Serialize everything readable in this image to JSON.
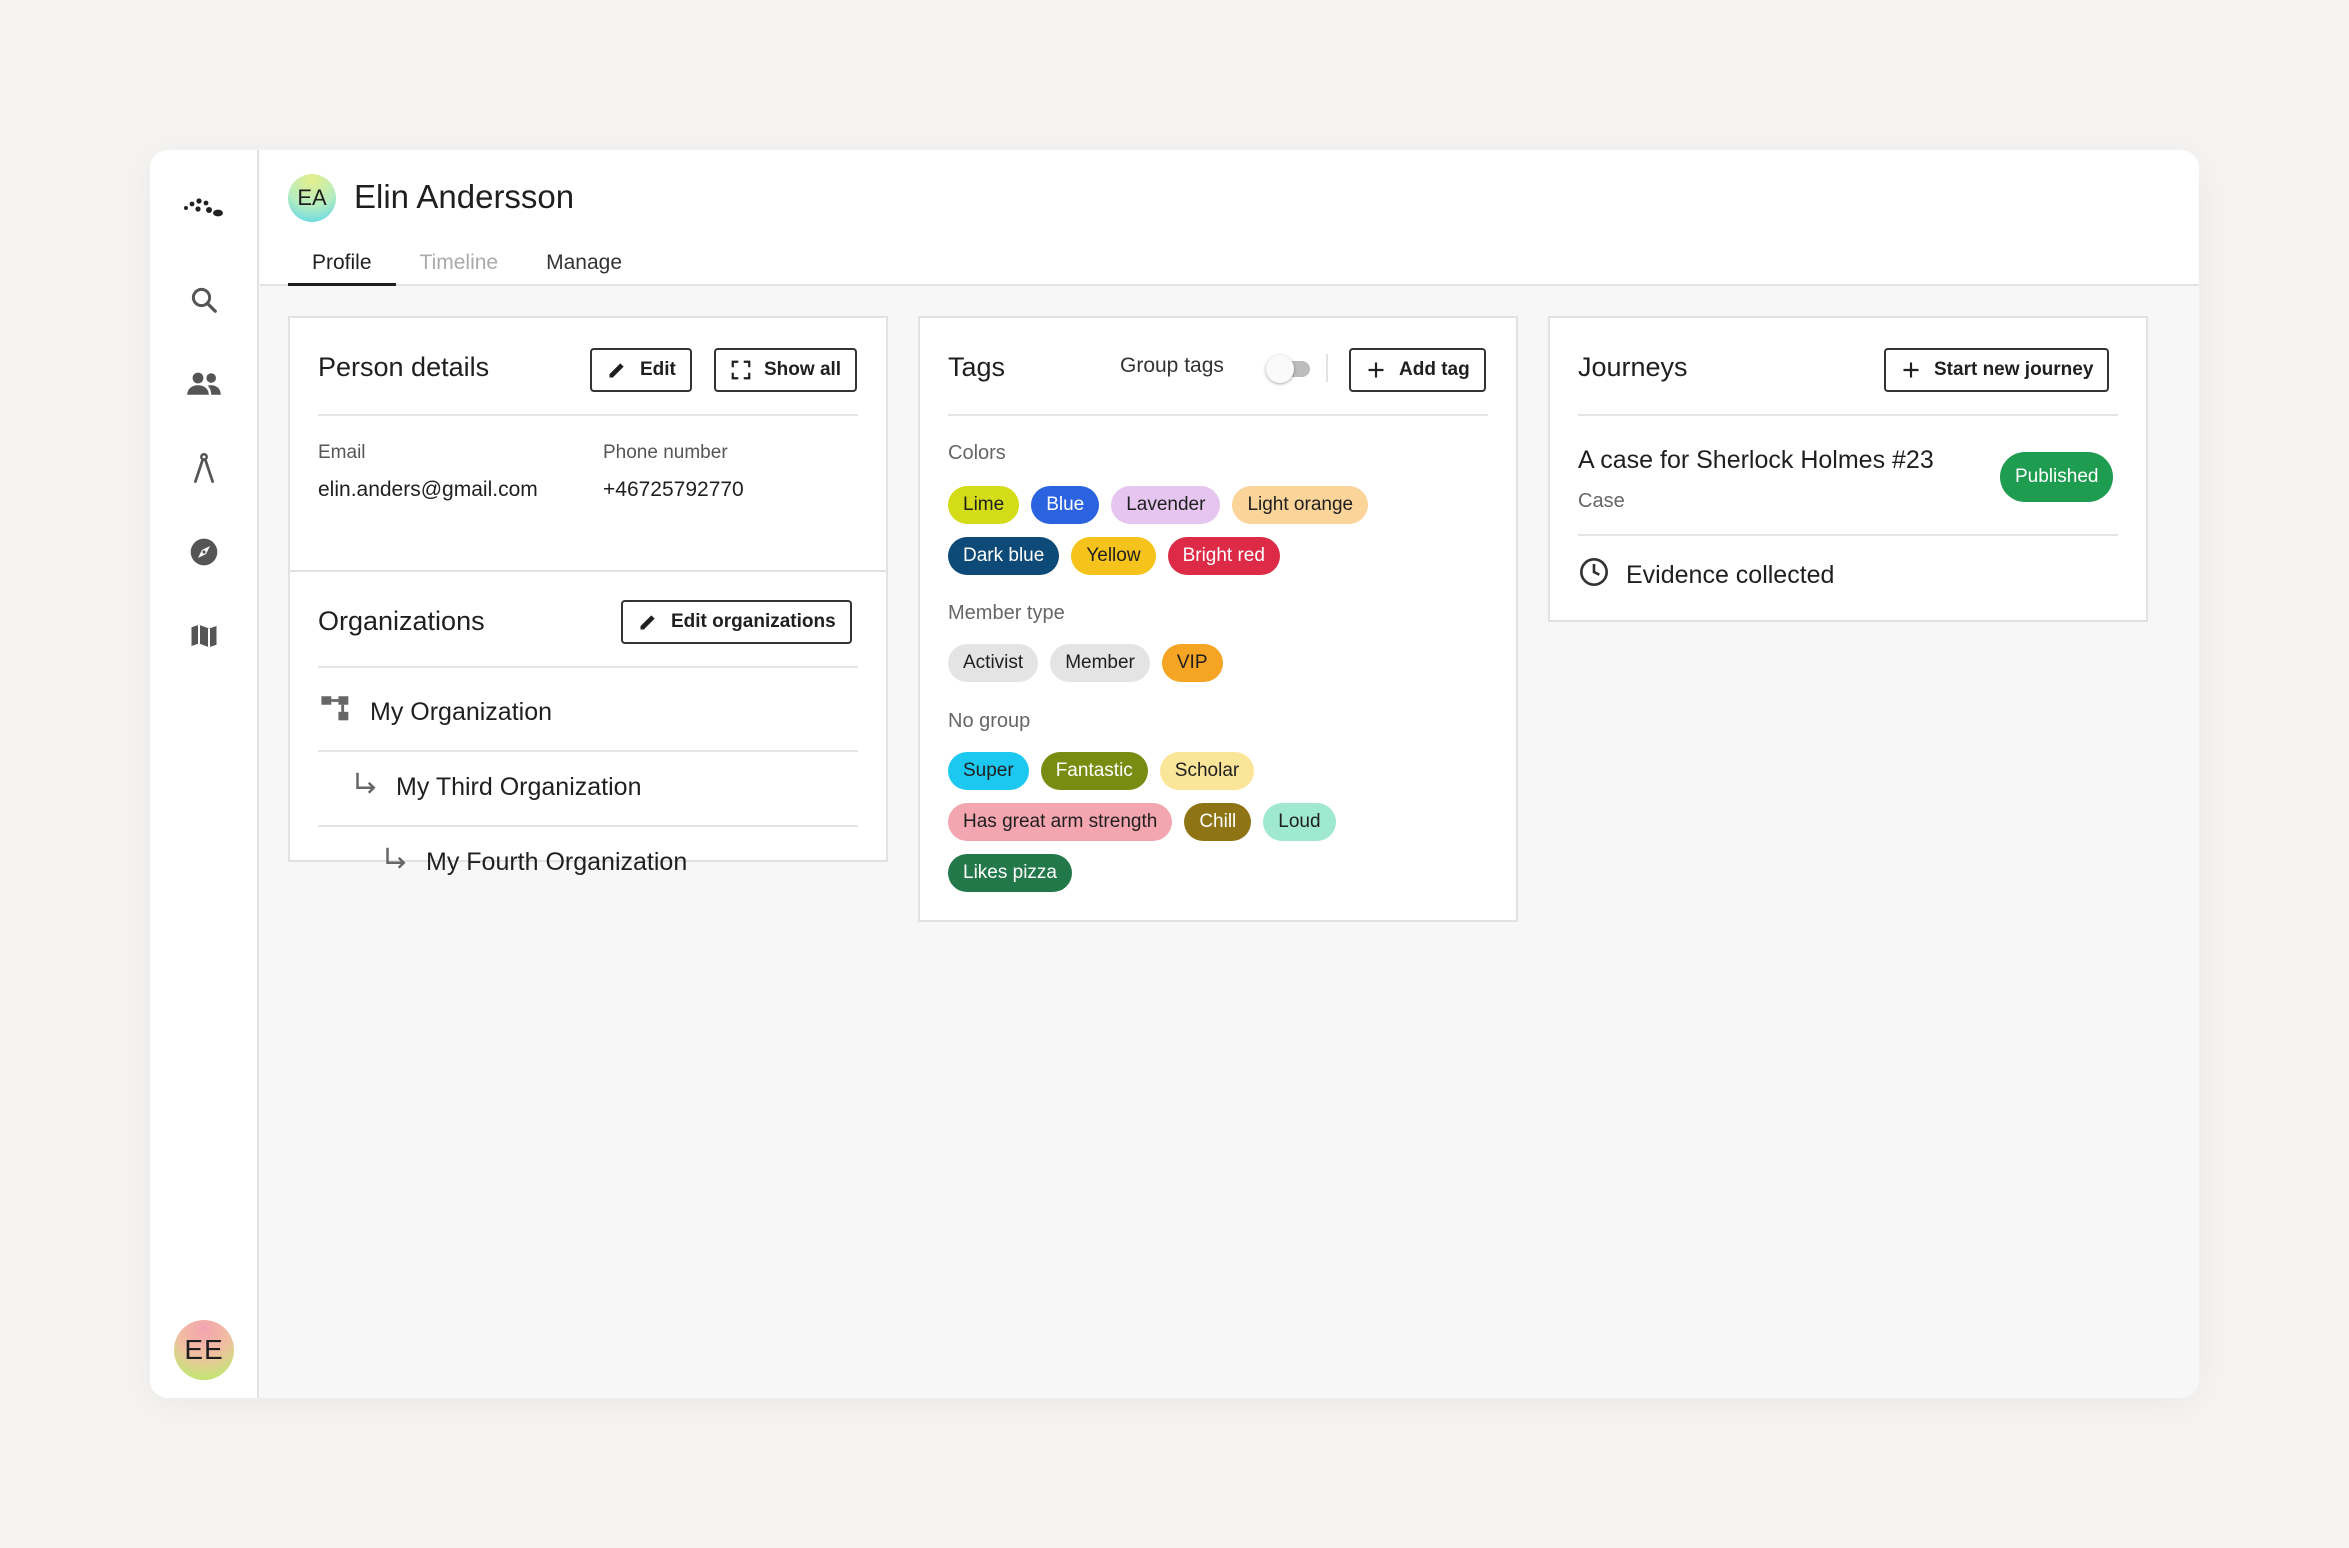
{
  "person": {
    "name": "Elin Andersson",
    "initials": "EA"
  },
  "user": {
    "initials": "EE"
  },
  "sidebar": {
    "icons": [
      "logo-icon",
      "search-icon",
      "people-icon",
      "compass-tool-icon",
      "explore-icon",
      "map-icon"
    ]
  },
  "tabs": [
    {
      "label": "Profile",
      "state": "active"
    },
    {
      "label": "Timeline",
      "state": "disabled"
    },
    {
      "label": "Manage",
      "state": "normal"
    }
  ],
  "details": {
    "title": "Person details",
    "edit_label": "Edit",
    "show_all_label": "Show all",
    "email_label": "Email",
    "email": "elin.anders@gmail.com",
    "phone_label": "Phone number",
    "phone": "+46725792770"
  },
  "orgs": {
    "title": "Organizations",
    "edit_label": "Edit organizations",
    "items": [
      "My Organization",
      "My Third Organization",
      "My Fourth Organization"
    ]
  },
  "tags": {
    "title": "Tags",
    "group_label": "Group tags",
    "group_enabled": false,
    "add_label": "Add tag",
    "groups": [
      {
        "name": "Colors",
        "rows": [
          [
            {
              "label": "Lime",
              "bg": "#d4dc18",
              "fg": "#1f1f1f"
            },
            {
              "label": "Blue",
              "bg": "#2a62e0",
              "fg": "#ffffff"
            },
            {
              "label": "Lavender",
              "bg": "#e6c6f0",
              "fg": "#1f1f1f"
            },
            {
              "label": "Light orange",
              "bg": "#fbd49a",
              "fg": "#1f1f1f"
            }
          ],
          [
            {
              "label": "Dark blue",
              "bg": "#0d4a78",
              "fg": "#ffffff"
            },
            {
              "label": "Yellow",
              "bg": "#f6c21c",
              "fg": "#1f1f1f"
            },
            {
              "label": "Bright red",
              "bg": "#dd2a47",
              "fg": "#ffffff"
            }
          ]
        ]
      },
      {
        "name": "Member type",
        "rows": [
          [
            {
              "label": "Activist",
              "bg": "#e4e4e4",
              "fg": "#1f1f1f"
            },
            {
              "label": "Member",
              "bg": "#e4e4e4",
              "fg": "#1f1f1f"
            },
            {
              "label": "VIP",
              "bg": "#f5a424",
              "fg": "#1f1f1f"
            }
          ]
        ]
      },
      {
        "name": "No group",
        "rows": [
          [
            {
              "label": "Super",
              "bg": "#1cc8ef",
              "fg": "#1f1f1f"
            },
            {
              "label": "Fantastic",
              "bg": "#788c12",
              "fg": "#ffffff"
            },
            {
              "label": "Scholar",
              "bg": "#fbe598",
              "fg": "#1f1f1f"
            }
          ],
          [
            {
              "label": "Has great arm strength",
              "bg": "#f3a6b0",
              "fg": "#1f1f1f"
            },
            {
              "label": "Chill",
              "bg": "#8e7414",
              "fg": "#ffffff"
            },
            {
              "label": "Loud",
              "bg": "#9ee9cf",
              "fg": "#1f1f1f"
            }
          ],
          [
            {
              "label": "Likes pizza",
              "bg": "#23784a",
              "fg": "#ffffff"
            }
          ]
        ]
      }
    ]
  },
  "journeys": {
    "title": "Journeys",
    "start_label": "Start new journey",
    "item": {
      "title": "A case for Sherlock Holmes",
      "number": "#23",
      "type": "Case",
      "status": "Published",
      "status_color": "#1e9c4f",
      "milestone": "Evidence collected"
    }
  }
}
